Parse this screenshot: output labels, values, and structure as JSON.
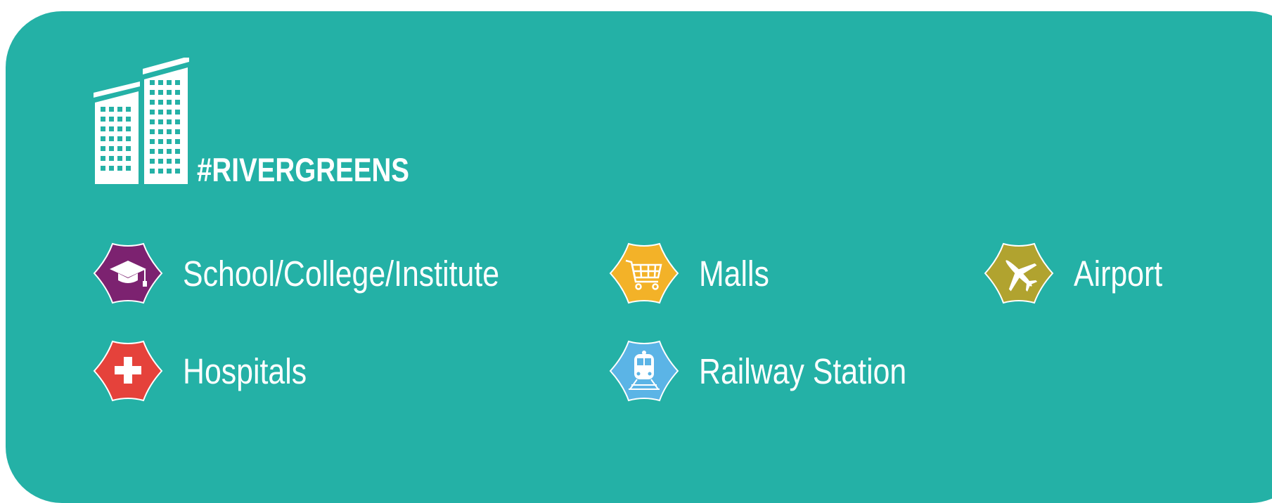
{
  "brand": {
    "title": "#RIVERGREENS",
    "logo_icon": "buildings-icon"
  },
  "colors": {
    "background": "#24b1a6",
    "text": "#ffffff",
    "school": "#7c2270",
    "malls": "#f3b228",
    "airport": "#b1a32f",
    "hospital": "#e5423b",
    "railway": "#5bb4e6"
  },
  "amenities": [
    {
      "label": "School/College/Institute",
      "icon": "graduation-cap-icon"
    },
    {
      "label": "Malls",
      "icon": "shopping-cart-icon"
    },
    {
      "label": "Airport",
      "icon": "airplane-icon"
    },
    {
      "label": "Hospitals",
      "icon": "medical-cross-icon"
    },
    {
      "label": "Railway Station",
      "icon": "train-icon"
    }
  ]
}
